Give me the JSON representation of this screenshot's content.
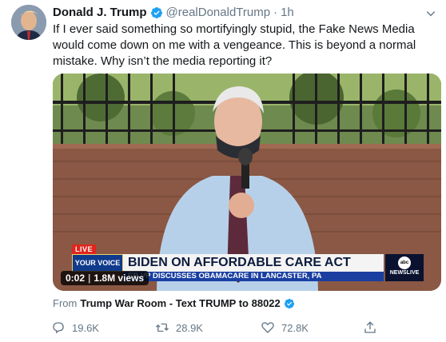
{
  "tweet": {
    "author": {
      "name": "Donald J. Trump",
      "handle": "@realDonaldTrump",
      "separator": "·",
      "time": "1h",
      "verified": true
    },
    "text": "If I ever said something so mortifyingly stupid, the Fake News Media would come down on me with a vengeance. This is beyond a normal mistake. Why isn’t the media reporting it?",
    "media": {
      "live_badge": "LIVE",
      "show_logo": "YOUR VOICE",
      "headline": "BIDEN ON AFFORDABLE CARE ACT",
      "subline": "ER VP DISCUSSES OBAMACARE IN LANCASTER, PA",
      "network_logo_circle": "abc",
      "network_logo_text": "NEWSLIVE",
      "duration": "0:02",
      "views": "1.8M views"
    },
    "source": {
      "prefix": "From",
      "name": "Trump War Room - Text TRUMP to 88022",
      "verified": true
    },
    "actions": {
      "replies": "19.6K",
      "retweets": "28.9K",
      "likes": "72.8K"
    }
  },
  "colors": {
    "verified_blue": "#1da1f2",
    "secondary_text": "#657786",
    "primary_text": "#14171a"
  },
  "icons": [
    "verified-icon",
    "caret-down-icon",
    "reply-icon",
    "retweet-icon",
    "like-icon",
    "share-icon"
  ]
}
